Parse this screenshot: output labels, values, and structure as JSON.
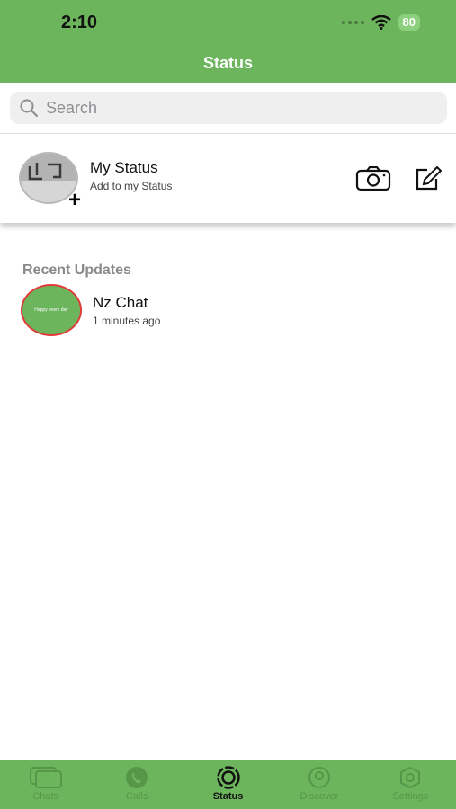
{
  "status_bar": {
    "time": "2:10",
    "battery": "80"
  },
  "header": {
    "title": "Status"
  },
  "search": {
    "placeholder": "Search"
  },
  "my_status": {
    "name": "My Status",
    "subtitle": "Add to my Status"
  },
  "recent": {
    "title": "Recent Updates",
    "items": [
      {
        "name": "Nz Chat",
        "time": "1 minutes ago",
        "preview_text": "Happy every day"
      }
    ]
  },
  "tabs": [
    {
      "label": "Chats",
      "icon": "chats-icon",
      "active": false
    },
    {
      "label": "Calls",
      "icon": "calls-icon",
      "active": false
    },
    {
      "label": "Status",
      "icon": "status-icon",
      "active": true
    },
    {
      "label": "Discover",
      "icon": "discover-icon",
      "active": false
    },
    {
      "label": "Settings",
      "icon": "settings-icon",
      "active": false
    }
  ],
  "colors": {
    "brand_green": "#6cb55d",
    "story_ring": "#e23a3a"
  }
}
